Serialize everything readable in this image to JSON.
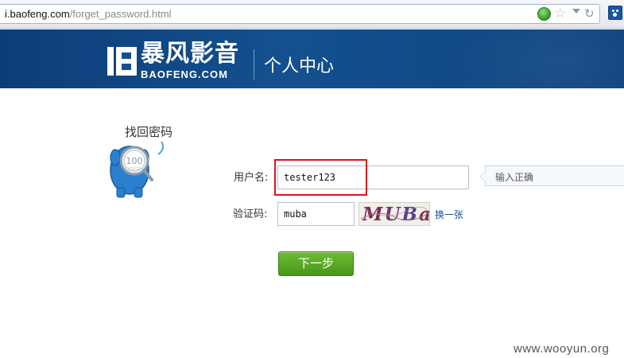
{
  "browser": {
    "url_host": "i.baofeng.com",
    "url_path": "/forget_password.html",
    "icons": [
      "go-icon",
      "bookmark-star-icon",
      "dropdown-icon",
      "refresh-icon",
      "extension-icon"
    ]
  },
  "header": {
    "logo_cn": "暴风影音",
    "logo_en": "BAOFENG.COM",
    "title": "个人中心",
    "colors": {
      "background": "#14508f",
      "text": "#ffffff"
    }
  },
  "main": {
    "heading": "找回密码",
    "mascot": "mascot-illustration",
    "form": {
      "username_label": "用户名:",
      "username_value": "tester123",
      "username_hint": "输入正确",
      "captcha_label": "验证码:",
      "captcha_value": "muba",
      "captcha_image_text": "MUBa",
      "refresh_captcha_label": "换一张",
      "submit_label": "下一步"
    },
    "colors": {
      "highlight": "#e0131b",
      "button": "#5aa928",
      "link": "#1a4f99"
    }
  },
  "watermark": "www.wooyun.org"
}
